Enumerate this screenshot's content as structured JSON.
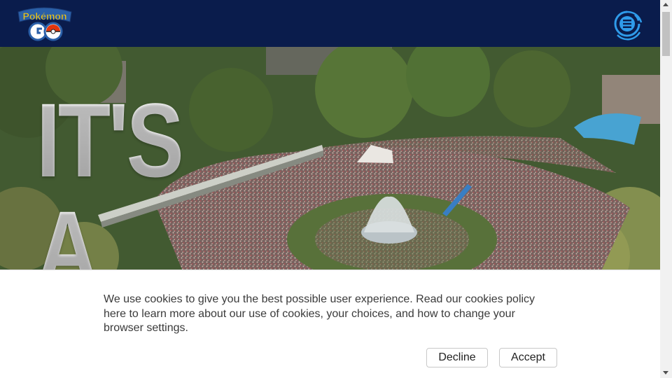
{
  "header": {
    "logo_top_text": "Pokémon",
    "logo_bottom_text": "GO",
    "menu_icon": "menu-ring-icon"
  },
  "hero": {
    "line1": "IT'S",
    "line2": "A"
  },
  "cookie_banner": {
    "message": "We use cookies to give you the best possible user experience. Read our cookies policy here to learn more about our use of cookies, your choices, and how to change your browser settings.",
    "decline_label": "Decline",
    "accept_label": "Accept"
  },
  "colors": {
    "header_bg": "#0a1c4c",
    "menu_accent": "#2f9bea",
    "logo_yellow": "#ffcb05",
    "logo_blue": "#2a5fa8"
  }
}
